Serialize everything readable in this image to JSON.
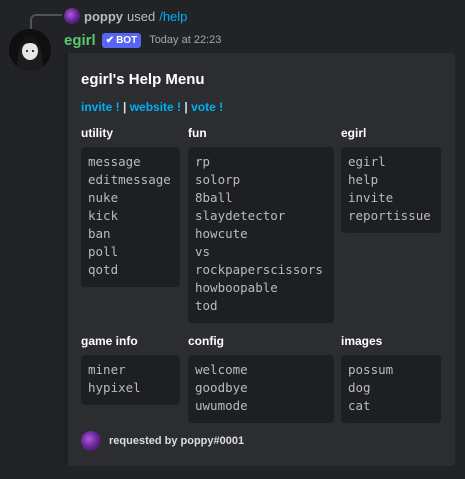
{
  "reply": {
    "username": "poppy",
    "used_text": "used",
    "command": "/help"
  },
  "message": {
    "author": "egirl",
    "bot_badge": "BOT",
    "bot_check": "✔",
    "timestamp": "Today at 22:23",
    "author_color": "#5ac771"
  },
  "embed": {
    "title": "egirl's Help Menu",
    "links": [
      {
        "label": "invite !"
      },
      {
        "label": "website !"
      },
      {
        "label": "vote !"
      }
    ],
    "separator": " | ",
    "fields": [
      {
        "name": "utility",
        "items": [
          "message",
          "editmessage",
          "nuke",
          "kick",
          "ban",
          "poll",
          "qotd"
        ]
      },
      {
        "name": "fun",
        "items": [
          "rp",
          "solorp",
          "8ball",
          "slaydetector",
          "howcute",
          "vs",
          "rockpaperscissors",
          "howboopable",
          "tod"
        ]
      },
      {
        "name": "egirl",
        "items": [
          "egirl",
          "help",
          "invite",
          "reportissue"
        ]
      },
      {
        "name": "game info",
        "items": [
          "miner",
          "hypixel"
        ]
      },
      {
        "name": "config",
        "items": [
          "welcome",
          "goodbye",
          "uwumode"
        ]
      },
      {
        "name": "images",
        "items": [
          "possum",
          "dog",
          "cat"
        ]
      }
    ],
    "footer": "requested by poppy#0001"
  },
  "colors": {
    "link": "#00aff4",
    "badge": "#5865f2",
    "background": "#222326",
    "embed_bg": "#2b2d31",
    "code_bg": "#1e1f22"
  },
  "icons": {
    "bot_verified": "checkmark-icon",
    "user_avatar": "avatar-icon"
  }
}
